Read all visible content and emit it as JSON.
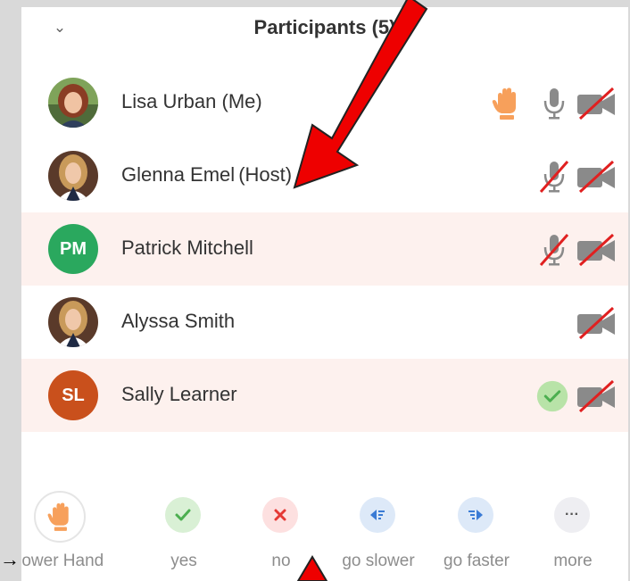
{
  "panel": {
    "title": "Participants (5)",
    "collapse_icon": "chevron-down-icon"
  },
  "participants": [
    {
      "name": "Lisa Urban (Me)",
      "role": "",
      "avatar": "photo",
      "hand_raised": true,
      "mic": "on",
      "video": "off",
      "status": ""
    },
    {
      "name": "Glenna Emel",
      "role": "(Host)",
      "avatar": "photo",
      "hand_raised": false,
      "mic": "muted",
      "video": "off",
      "status": ""
    },
    {
      "name": "Patrick Mitchell",
      "role": "",
      "avatar": "initials",
      "initials": "PM",
      "avatar_color": "#2aa85e",
      "hand_raised": false,
      "mic": "muted",
      "video": "off",
      "status": ""
    },
    {
      "name": "Alyssa Smith",
      "role": "",
      "avatar": "photo",
      "hand_raised": false,
      "mic": "none",
      "video": "off",
      "status": ""
    },
    {
      "name": "Sally Learner",
      "role": "",
      "avatar": "initials",
      "initials": "SL",
      "avatar_color": "#c9501c",
      "hand_raised": false,
      "mic": "none",
      "video": "off",
      "status": "yes"
    }
  ],
  "reactions": [
    {
      "label": "Lower Hand",
      "icon": "raised-hand-icon",
      "bg": "#ffffff"
    },
    {
      "label": "yes",
      "icon": "checkmark-icon",
      "bg": "#d9f0d5",
      "glyph": "✓",
      "color": "#4caf50"
    },
    {
      "label": "no",
      "icon": "x-icon",
      "bg": "#fde0e0",
      "glyph": "✕",
      "color": "#e53935"
    },
    {
      "label": "go slower",
      "icon": "rewind-icon",
      "bg": "#dde9f8",
      "glyph": "◂≡",
      "color": "#3a7bd5"
    },
    {
      "label": "go faster",
      "icon": "fast-forward-icon",
      "bg": "#dde9f8",
      "glyph": "≡▸",
      "color": "#3a7bd5"
    },
    {
      "label": "more",
      "icon": "more-dots-icon",
      "bg": "#eeeef2",
      "glyph": "···",
      "color": "#555"
    }
  ],
  "colors": {
    "highlight_row": "#fdf1ee",
    "annotation_arrow": "#ee0000",
    "hand": "#f7a05b"
  }
}
